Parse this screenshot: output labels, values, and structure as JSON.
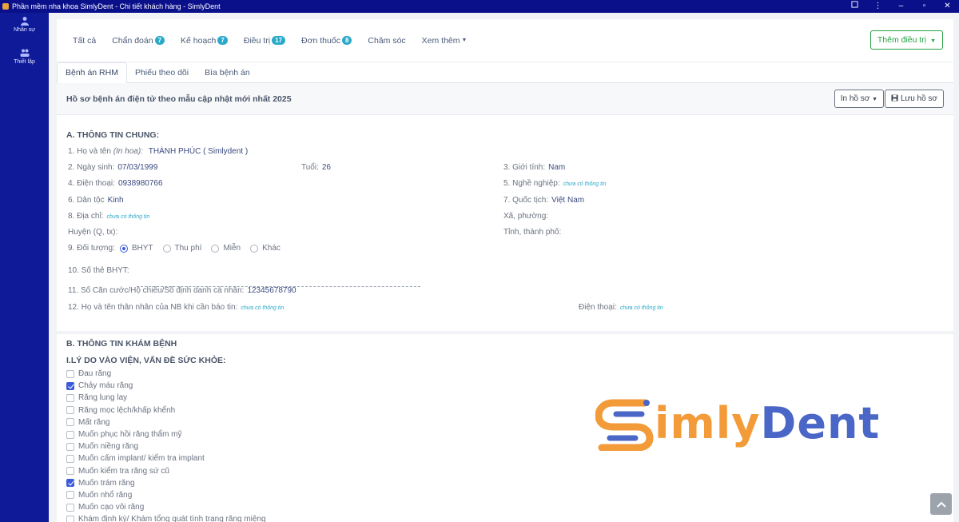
{
  "window": {
    "title": "Phần mềm nha khoa SimlyDent - Chi tiết khách hàng - SimlyDent"
  },
  "sidebar": {
    "items": [
      {
        "label": "Nhân sự"
      },
      {
        "label": "Thiết lập"
      }
    ]
  },
  "topnav": {
    "items": [
      {
        "label": "Tất cả",
        "count": ""
      },
      {
        "label": "Chẩn đoán",
        "count": "7"
      },
      {
        "label": "Kế hoạch",
        "count": "7"
      },
      {
        "label": "Điều trị",
        "count": "17"
      },
      {
        "label": "Đơn thuốc",
        "count": "8"
      },
      {
        "label": "Chăm sóc",
        "count": ""
      },
      {
        "label": "Xem thêm",
        "count": ""
      }
    ],
    "add_button": "Thêm điều trị"
  },
  "subtabs": [
    {
      "label": "Bệnh án RHM"
    },
    {
      "label": "Phiếu theo dõi"
    },
    {
      "label": "Bìa bệnh án"
    }
  ],
  "header": {
    "title": "Hồ sơ bệnh án điện tử theo mẫu cập nhật mới nhất 2025",
    "print_button": "In hồ sơ",
    "save_button": "Lưu hồ sơ"
  },
  "sectionA": {
    "title": "A. THÔNG TIN CHUNG:",
    "name_label": "1. Họ và tên",
    "name_hint": "(In hoa):",
    "name_value": "THÀNH PHÚC ( Simlydent )",
    "dob_label": "2. Ngày sinh:",
    "dob_value": "07/03/1999",
    "age_label": "Tuổi:",
    "age_value": "26",
    "gender_label": "3. Giới tính:",
    "gender_value": "Nam",
    "phone_label": "4. Điện thoại:",
    "phone_value": "0938980766",
    "job_label": "5. Nghề nghiệp:",
    "empty_text": "chưa có thông tin",
    "ethnic_label": "6. Dân tộc",
    "ethnic_value": "Kinh",
    "nation_label": "7. Quốc tịch:",
    "nation_value": "Việt Nam",
    "address_label": "8. Địa chỉ:",
    "ward_label": "Xã, phường:",
    "district_label": "Huyện (Q, tx):",
    "city_label": "Tỉnh, thành phố:",
    "subject_label": "9. Đối tượng:",
    "subject_options": [
      "BHYT",
      "Thu phí",
      "Miễn",
      "Khác"
    ],
    "insurance_label": "10. Số thẻ BHYT:",
    "id_label": "11. Số Căn cước/Hộ chiếu/Số định danh cá nhân:",
    "id_value": "12345678790",
    "relative_label": "12. Họ và tên thân nhân của NB khi cần báo tin:",
    "relative_phone_label": "Điện thoại:"
  },
  "sectionB": {
    "title": "B. THÔNG TIN KHÁM BỆNH",
    "subtitle": "I.LÝ DO VÀO VIỆN, VẤN ĐỀ SỨC KHỎE:",
    "reasons": [
      {
        "label": "Đau răng",
        "checked": false
      },
      {
        "label": "Chảy máu răng",
        "checked": true
      },
      {
        "label": "Răng lung lay",
        "checked": false
      },
      {
        "label": "Răng mọc lệch/khấp khểnh",
        "checked": false
      },
      {
        "label": "Mất răng",
        "checked": false
      },
      {
        "label": "Muốn phục hồi răng thẩm mỹ",
        "checked": false
      },
      {
        "label": "Muốn niềng răng",
        "checked": false
      },
      {
        "label": "Muốn cấm implant/ kiểm tra implant",
        "checked": false
      },
      {
        "label": "Muốn kiểm tra răng sứ cũ",
        "checked": false
      },
      {
        "label": "Muốn trám răng",
        "checked": true
      },
      {
        "label": "Muốn nhổ răng",
        "checked": false
      },
      {
        "label": "Muốn cạo vôi răng",
        "checked": false
      },
      {
        "label": "Khám định kỳ/ Khám tổng quát tình trạng răng miệng",
        "checked": false
      }
    ]
  },
  "logo": {
    "part1": "imly",
    "part2": "Dent"
  },
  "colors": {
    "titlebar": "#0a0f8a",
    "sidebar": "#0f1a99",
    "accent_green": "#25a244",
    "badge": "#2aa9c9",
    "logo_orange": "#f29b38",
    "logo_blue": "#4a66c6"
  }
}
